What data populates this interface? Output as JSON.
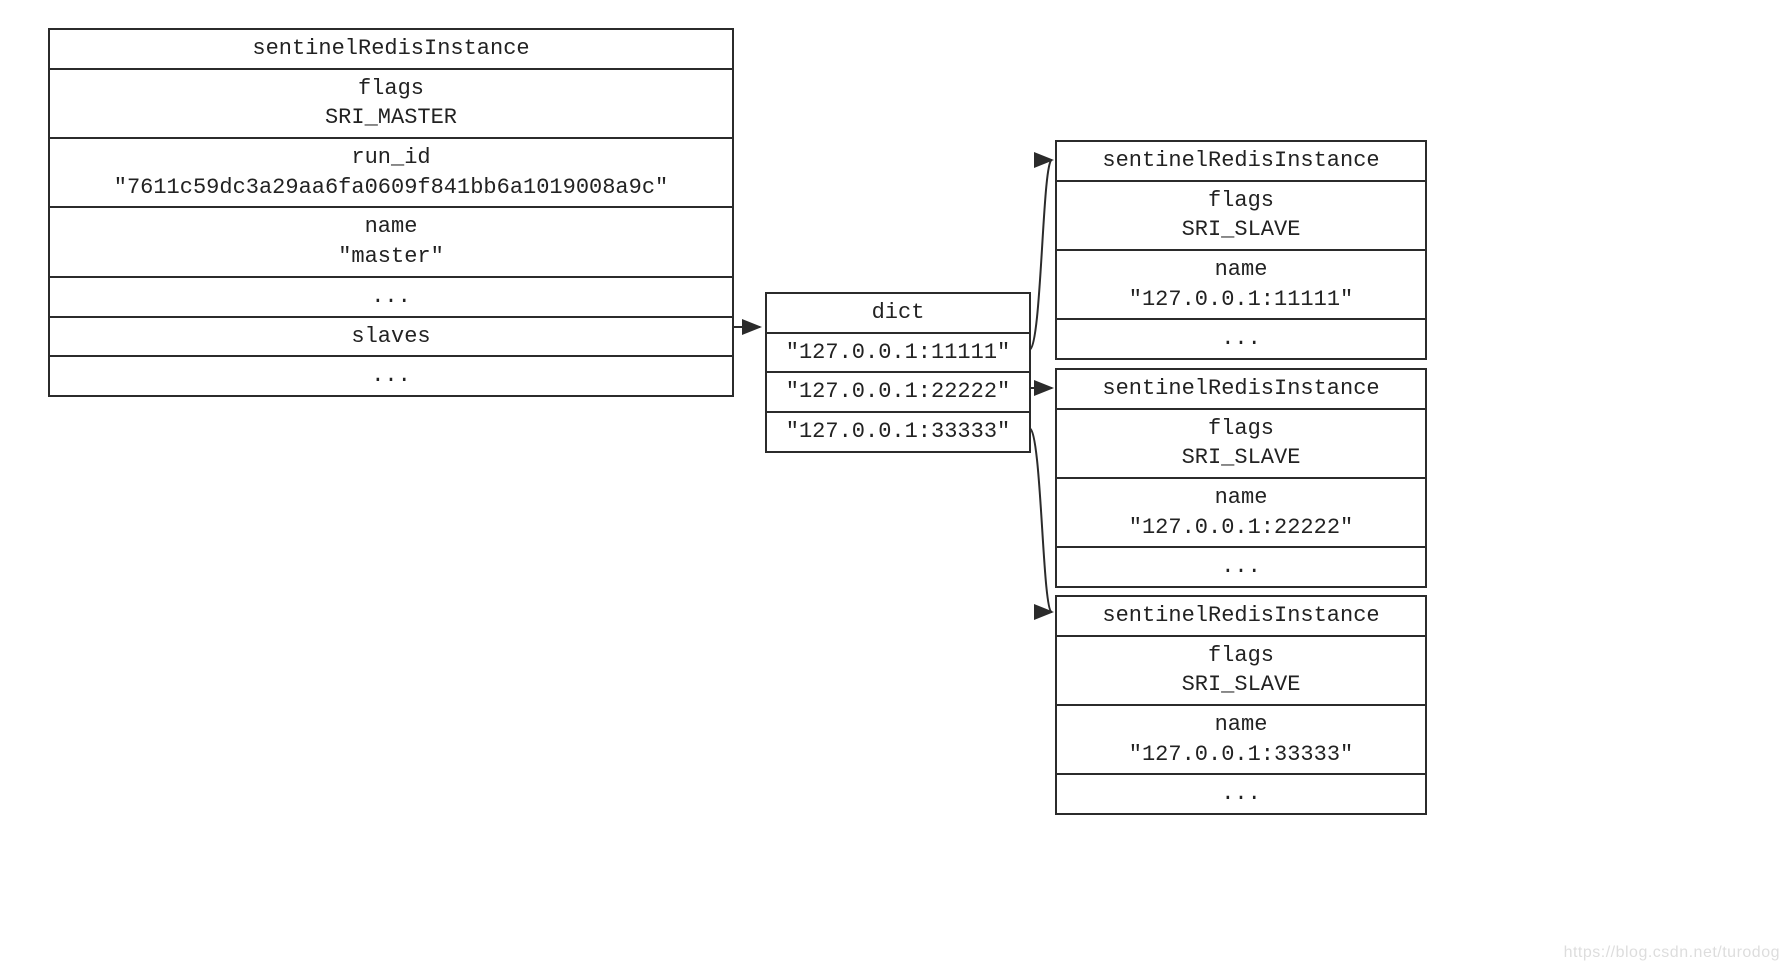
{
  "master": {
    "title": "sentinelRedisInstance",
    "flags_label": "flags",
    "flags_value": "SRI_MASTER",
    "runid_label": "run_id",
    "runid_value": "\"7611c59dc3a29aa6fa0609f841bb6a1019008a9c\"",
    "name_label": "name",
    "name_value": "\"master\"",
    "ellipsis1": "...",
    "slaves_label": "slaves",
    "ellipsis2": "..."
  },
  "dict": {
    "title": "dict",
    "entries": [
      "\"127.0.0.1:11111\"",
      "\"127.0.0.1:22222\"",
      "\"127.0.0.1:33333\""
    ]
  },
  "slaves": [
    {
      "title": "sentinelRedisInstance",
      "flags_label": "flags",
      "flags_value": "SRI_SLAVE",
      "name_label": "name",
      "name_value": "\"127.0.0.1:11111\"",
      "ellipsis": "..."
    },
    {
      "title": "sentinelRedisInstance",
      "flags_label": "flags",
      "flags_value": "SRI_SLAVE",
      "name_label": "name",
      "name_value": "\"127.0.0.1:22222\"",
      "ellipsis": "..."
    },
    {
      "title": "sentinelRedisInstance",
      "flags_label": "flags",
      "flags_value": "SRI_SLAVE",
      "name_label": "name",
      "name_value": "\"127.0.0.1:33333\"",
      "ellipsis": "..."
    }
  ],
  "watermark": "https://blog.csdn.net/turodog"
}
